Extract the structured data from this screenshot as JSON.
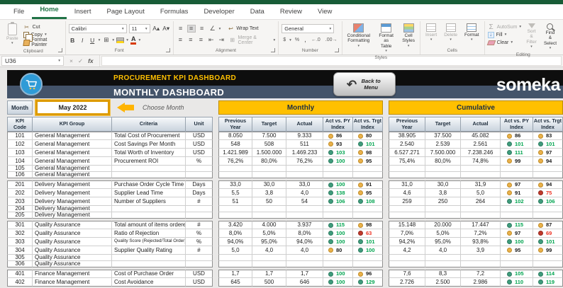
{
  "ribbon": {
    "tabs": [
      "File",
      "Home",
      "Insert",
      "Page Layout",
      "Formulas",
      "Developer",
      "Data",
      "Review",
      "View"
    ],
    "active_tab": "Home",
    "clipboard": {
      "label": "Clipboard",
      "paste": "Paste",
      "cut": "Cut",
      "copy": "Copy",
      "format_painter": "Format Painter"
    },
    "font": {
      "label": "Font",
      "font_name": "Calibri",
      "font_size": "11",
      "bold": "B",
      "italic": "I",
      "underline": "U"
    },
    "alignment": {
      "label": "Alignment",
      "wrap_text": "Wrap Text",
      "merge_center": "Merge & Center"
    },
    "number": {
      "label": "Number",
      "format": "General",
      "percent": "%",
      "comma": ",",
      "inc_dec": "←.0",
      "dec_dec": ".00→"
    },
    "styles": {
      "label": "Styles",
      "conditional": "Conditional\nFormatting",
      "format_table": "Format as\nTable",
      "cell_styles": "Cell\nStyles"
    },
    "cells": {
      "label": "Cells",
      "insert": "Insert",
      "delete": "Delete",
      "format": "Format"
    },
    "editing": {
      "label": "Editing",
      "autosum": "AutoSum",
      "fill": "Fill",
      "clear": "Clear",
      "sort": "Sort &\nFilter",
      "find": "Find &\nSelect"
    }
  },
  "formula_bar": {
    "name_box": "U36",
    "cancel": "×",
    "enter": "✓",
    "fx": "fx",
    "value": ""
  },
  "dashboard": {
    "title": "PROCUREMENT KPI DASHBOARD",
    "subtitle": "MONTHLY DASHBOARD",
    "logo": "someka",
    "back_button": "Back to Menu",
    "month_label": "Month",
    "month_value": "May 2022",
    "choose_month": "Choose Month",
    "section_monthly": "Monthly",
    "section_cumulative": "Cumulative"
  },
  "table": {
    "headers": {
      "code": "KPI\nCode",
      "group": "KPI Group",
      "criteria": "Criteria",
      "unit": "Unit",
      "py": "Previous\nYear",
      "target": "Target",
      "actual": "Actual",
      "act_py": "Act vs. PY\nIndex",
      "act_trgt": "Act vs. Trgt\nIndex"
    },
    "rows": [
      {
        "code": "101",
        "group": "General Management",
        "criteria": "Total Cost of Procurement",
        "unit": "USD",
        "m": [
          "8.050",
          "7.500",
          "9.333"
        ],
        "mi": [
          [
            "86",
            "amber"
          ],
          [
            "80",
            "amber"
          ]
        ],
        "c": [
          "38.905",
          "37.500",
          "45.082"
        ],
        "ci": [
          [
            "86",
            "amber"
          ],
          [
            "83",
            "amber"
          ]
        ]
      },
      {
        "code": "102",
        "group": "General Management",
        "criteria": "Cost Savings Per Month",
        "unit": "USD",
        "m": [
          "548",
          "508",
          "511"
        ],
        "mi": [
          [
            "93",
            "amber"
          ],
          [
            "101",
            "green"
          ]
        ],
        "c": [
          "2.540",
          "2.539",
          "2.561"
        ],
        "ci": [
          [
            "101",
            "green"
          ],
          [
            "101",
            "green"
          ]
        ]
      },
      {
        "code": "103",
        "group": "General Management",
        "criteria": "Total Worth of Inventory",
        "unit": "USD",
        "m": [
          "1.421.989",
          "1.500.000",
          "1.469.233"
        ],
        "mi": [
          [
            "103",
            "green"
          ],
          [
            "98",
            "amber"
          ]
        ],
        "c": [
          "6.527.271",
          "7.500.000",
          "7.238.246"
        ],
        "ci": [
          [
            "111",
            "green"
          ],
          [
            "97",
            "amber"
          ]
        ]
      },
      {
        "code": "104",
        "group": "General Management",
        "criteria": "Procurement ROI",
        "unit": "%",
        "m": [
          "76,2%",
          "80,0%",
          "76,2%"
        ],
        "mi": [
          [
            "100",
            "green"
          ],
          [
            "95",
            "amber"
          ]
        ],
        "c": [
          "75,4%",
          "80,0%",
          "74,8%"
        ],
        "ci": [
          [
            "99",
            "amber"
          ],
          [
            "94",
            "amber"
          ]
        ]
      },
      {
        "code": "105",
        "group": "General Management",
        "criteria": "",
        "unit": "",
        "m": null,
        "mi": null,
        "c": null,
        "ci": null
      },
      {
        "code": "106",
        "group": "General Management",
        "criteria": "",
        "unit": "",
        "m": null,
        "mi": null,
        "c": null,
        "ci": null
      },
      {
        "code": "201",
        "group": "Delivery Management",
        "criteria": "Purchase Order Cycle Time",
        "unit": "Days",
        "ng": true,
        "m": [
          "33,0",
          "30,0",
          "33,0"
        ],
        "mi": [
          [
            "100",
            "green"
          ],
          [
            "91",
            "amber"
          ]
        ],
        "c": [
          "31,0",
          "30,0",
          "31,9"
        ],
        "ci": [
          [
            "97",
            "amber"
          ],
          [
            "94",
            "amber"
          ]
        ]
      },
      {
        "code": "202",
        "group": "Delivery Management",
        "criteria": "Supplier Lead Time",
        "unit": "Days",
        "m": [
          "5,5",
          "3,8",
          "4,0"
        ],
        "mi": [
          [
            "138",
            "green"
          ],
          [
            "95",
            "amber"
          ]
        ],
        "c": [
          "4,6",
          "3,8",
          "5,0"
        ],
        "ci": [
          [
            "91",
            "amber"
          ],
          [
            "75",
            "red"
          ]
        ]
      },
      {
        "code": "203",
        "group": "Delivery Management",
        "criteria": "Number of Suppliers",
        "unit": "#",
        "m": [
          "51",
          "50",
          "54"
        ],
        "mi": [
          [
            "106",
            "green"
          ],
          [
            "108",
            "green"
          ]
        ],
        "c": [
          "259",
          "250",
          "264"
        ],
        "ci": [
          [
            "102",
            "green"
          ],
          [
            "106",
            "green"
          ]
        ]
      },
      {
        "code": "204",
        "group": "Delivery Management",
        "criteria": "",
        "unit": "",
        "m": null,
        "mi": null,
        "c": null,
        "ci": null
      },
      {
        "code": "205",
        "group": "Delivery Management",
        "criteria": "",
        "unit": "",
        "m": null,
        "mi": null,
        "c": null,
        "ci": null
      },
      {
        "code": "301",
        "group": "Quality Assurance",
        "criteria": "Total amount of items ordered",
        "unit": "#",
        "ng": true,
        "m": [
          "3.420",
          "4.000",
          "3.937"
        ],
        "mi": [
          [
            "115",
            "green"
          ],
          [
            "98",
            "amber"
          ]
        ],
        "c": [
          "15.148",
          "20.000",
          "17.447"
        ],
        "ci": [
          [
            "115",
            "green"
          ],
          [
            "87",
            "amber"
          ]
        ]
      },
      {
        "code": "302",
        "group": "Quality Assurance",
        "criteria": "Ratio of Rejection",
        "unit": "%",
        "m": [
          "8,0%",
          "5,0%",
          "8,0%"
        ],
        "mi": [
          [
            "100",
            "green"
          ],
          [
            "63",
            "red"
          ]
        ],
        "c": [
          "7,0%",
          "5,0%",
          "7,2%"
        ],
        "ci": [
          [
            "97",
            "amber"
          ],
          [
            "69",
            "red"
          ]
        ]
      },
      {
        "code": "303",
        "group": "Quality Assurance",
        "criteria": "Quality Score (Rejected/Total Order)",
        "unit": "%",
        "m": [
          "94,0%",
          "95,0%",
          "94,0%"
        ],
        "mi": [
          [
            "100",
            "green"
          ],
          [
            "101",
            "green"
          ]
        ],
        "c": [
          "94,2%",
          "95,0%",
          "93,8%"
        ],
        "ci": [
          [
            "100",
            "green"
          ],
          [
            "101",
            "green"
          ]
        ]
      },
      {
        "code": "304",
        "group": "Quality Assurance",
        "criteria": "Supplier Quality Rating",
        "unit": "#",
        "m": [
          "5,0",
          "4,0",
          "4,0"
        ],
        "mi": [
          [
            "80",
            "amber"
          ],
          [
            "100",
            "green"
          ]
        ],
        "c": [
          "4,2",
          "4,0",
          "3,9"
        ],
        "ci": [
          [
            "95",
            "amber"
          ],
          [
            "99",
            "amber"
          ]
        ]
      },
      {
        "code": "305",
        "group": "Quality Assurance",
        "criteria": "",
        "unit": "",
        "m": null,
        "mi": null,
        "c": null,
        "ci": null
      },
      {
        "code": "306",
        "group": "Quality Assurance",
        "criteria": "",
        "unit": "",
        "m": null,
        "mi": null,
        "c": null,
        "ci": null
      },
      {
        "code": "401",
        "group": "Finance Management",
        "criteria": "Cost of Purchase Order",
        "unit": "USD",
        "ng": true,
        "m": [
          "1,7",
          "1,7",
          "1,7"
        ],
        "mi": [
          [
            "100",
            "green"
          ],
          [
            "96",
            "amber"
          ]
        ],
        "c": [
          "7,6",
          "8,3",
          "7,2"
        ],
        "ci": [
          [
            "105",
            "green"
          ],
          [
            "114",
            "green"
          ]
        ]
      },
      {
        "code": "402",
        "group": "Finance Management",
        "criteria": "Cost Avoidance",
        "unit": "USD",
        "m": [
          "645",
          "500",
          "646"
        ],
        "mi": [
          [
            "100",
            "green"
          ],
          [
            "129",
            "green"
          ]
        ],
        "c": [
          "2.726",
          "2.500",
          "2.986"
        ],
        "ci": [
          [
            "110",
            "green"
          ],
          [
            "119",
            "green"
          ]
        ]
      }
    ]
  },
  "colors": {
    "excel_green": "#185c37",
    "accent_gold": "#ffc000",
    "slate": "#44546a",
    "dot_green": "#3f9c7c",
    "dot_amber": "#eab14a",
    "dot_red": "#c0392b",
    "text_green": "#00a44f",
    "text_red": "#ed3324"
  }
}
